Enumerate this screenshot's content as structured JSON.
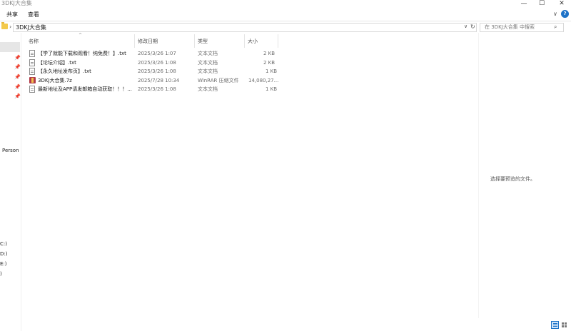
{
  "window": {
    "title": "3DKJ大合集",
    "minimize": "—",
    "maximize": "☐",
    "close": "✕"
  },
  "ribbon": {
    "tabs": [
      "共享",
      "查看"
    ],
    "expand": "∨",
    "help": "?"
  },
  "address": {
    "separator": "›",
    "path": "3DKJ大合集",
    "dropdown": "∨",
    "refresh": "↻"
  },
  "search": {
    "placeholder": "在 3DKJ大合集 中搜索",
    "icon": "⌕"
  },
  "nav": {
    "pin": "📌",
    "personal": "Person",
    "drives": [
      "C:)",
      "D:)",
      "E:)",
      ")"
    ]
  },
  "columns": {
    "sort_arrow": "^",
    "name": "名称",
    "modified": "修改日期",
    "type": "类型",
    "size": "大小"
  },
  "files": [
    {
      "name": "【学了就能下载和观看！纯免费！】.txt",
      "modified": "2025/3/26 1:07",
      "type": "文本文档",
      "size": "2 KB",
      "icon": "text-file-icon"
    },
    {
      "name": "【论坛介绍】.txt",
      "modified": "2025/3/26 1:08",
      "type": "文本文档",
      "size": "2 KB",
      "icon": "text-file-icon"
    },
    {
      "name": "【永久地址发布页】.txt",
      "modified": "2025/3/26 1:08",
      "type": "文本文档",
      "size": "1 KB",
      "icon": "text-file-icon"
    },
    {
      "name": "3DKJ大合集.7z",
      "modified": "2025/7/28 10:34",
      "type": "WinRAR 压缩文件",
      "size": "14,080,27...",
      "icon": "winrar-archive-icon"
    },
    {
      "name": "最新地址及APP请发邮箱自动获取！！！...",
      "modified": "2025/3/26 1:08",
      "type": "文本文档",
      "size": "1 KB",
      "icon": "text-file-icon"
    }
  ],
  "preview": {
    "message": "选择要预览的文件。"
  },
  "colors": {
    "accent": "#1e73c8",
    "folder": "#f3c94b"
  }
}
